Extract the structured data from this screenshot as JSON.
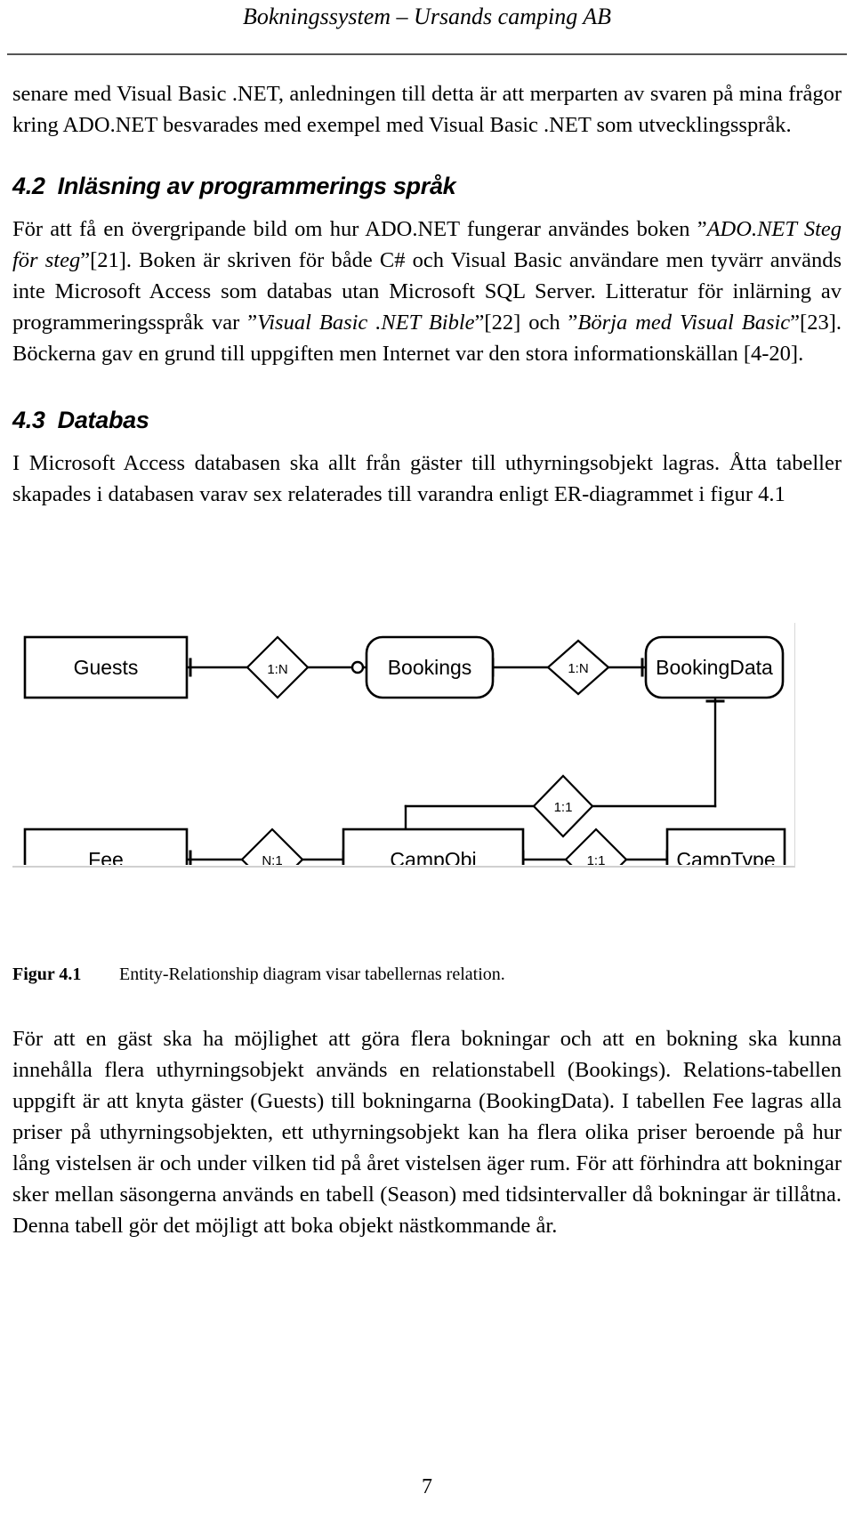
{
  "header": {
    "title": "Bokningssystem – Ursands camping AB"
  },
  "content": {
    "intro_paragraph": "senare med Visual Basic .NET, anledningen till detta är att merparten av svaren på mina frågor kring ADO.NET besvarades med exempel med Visual Basic .NET som utvecklingsspråk.",
    "section_42": {
      "number": "4.2",
      "title": "Inläsning av programmerings språk",
      "p1_a": "För att få en övergripande bild om hur ADO.NET fungerar användes boken ”",
      "p1_cite1": "ADO.NET Steg för steg",
      "p1_b": "”[21]. Boken är skriven för både C# och Visual Basic användare men tyvärr används inte Microsoft Access som databas utan Microsoft SQL Server. Litteratur för inlärning av programmeringsspråk var ”",
      "p1_cite2": "Visual Basic .NET Bible",
      "p1_c": "”[22] och ”",
      "p1_cite3": "Börja med Visual Basic",
      "p1_d": "”[23]. Böckerna gav en grund till uppgiften men Internet var den stora informationskällan [4-20]."
    },
    "section_43": {
      "number": "4.3",
      "title": "Databas",
      "p1": "I Microsoft Access databasen ska allt från gäster till uthyrningsobjekt lagras. Åtta tabeller skapades i databasen varav sex relaterades till varandra enligt ER-diagrammet i figur 4.1"
    },
    "figure": {
      "caption_label": "Figur 4.1",
      "caption_text": "Entity-Relationship diagram visar tabellernas relation.",
      "entities": [
        {
          "id": "guests",
          "label": "Guests",
          "shape": "rect"
        },
        {
          "id": "bookings",
          "label": "Bookings",
          "shape": "rounded"
        },
        {
          "id": "bookingdata",
          "label": "BookingData",
          "shape": "rounded"
        },
        {
          "id": "fee",
          "label": "Fee",
          "shape": "rect"
        },
        {
          "id": "campobj",
          "label": "CampObj",
          "shape": "rect"
        },
        {
          "id": "camptype",
          "label": "CampType",
          "shape": "rect"
        }
      ],
      "relationships": [
        {
          "id": "guests-bookings",
          "label": "1:N",
          "from": "Guests",
          "to": "Bookings"
        },
        {
          "id": "bookings-bookingdata",
          "label": "1:N",
          "from": "Bookings",
          "to": "BookingData"
        },
        {
          "id": "bookingdata-campobj",
          "label": "1:1",
          "from": "BookingData",
          "to": "CampObj"
        },
        {
          "id": "fee-campobj",
          "label": "N:1",
          "from": "Fee",
          "to": "CampObj"
        },
        {
          "id": "campobj-camptype",
          "label": "1:1",
          "from": "CampObj",
          "to": "CampType"
        }
      ]
    },
    "tail_paragraph_1": "För att en gäst ska ha möjlighet att göra flera bokningar och att en bokning ska kunna innehålla flera uthyrningsobjekt används en relationstabell (Bookings). Relations-tabellen uppgift är att knyta gäster (Guests) till bokningarna (BookingData). I tabellen Fee lagras alla priser på uthyrningsobjekten, ett uthyrningsobjekt kan ha flera olika priser beroende på hur lång vistelsen är och under vilken tid på året vistelsen äger rum. För att förhindra att bokningar sker mellan säsongerna används en tabell (Season) med tidsintervaller då bokningar är tillåtna. Denna tabell gör det möjligt att boka objekt nästkommande år."
  },
  "footer": {
    "page_number": "7"
  }
}
